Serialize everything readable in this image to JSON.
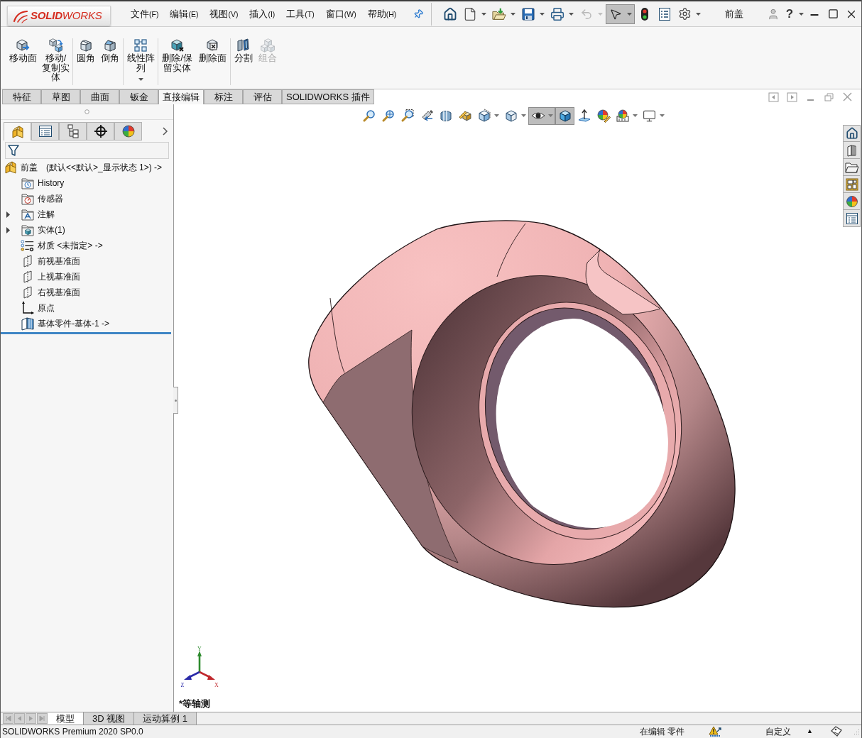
{
  "logo": {
    "text": "**SOLID**WORKS"
  },
  "menu": [
    {
      "label": "文件",
      "key": "(F)"
    },
    {
      "label": "编辑",
      "key": "(E)"
    },
    {
      "label": "视图",
      "key": "(V)"
    },
    {
      "label": "插入",
      "key": "(I)"
    },
    {
      "label": "工具",
      "key": "(T)"
    },
    {
      "label": "窗口",
      "key": "(W)"
    },
    {
      "label": "帮助",
      "key": "(H)"
    }
  ],
  "quick_access": [
    {
      "kind": "home",
      "dropdown": false,
      "disabled": false,
      "selected": false
    },
    {
      "kind": "new",
      "dropdown": true,
      "disabled": false,
      "selected": false
    },
    {
      "kind": "open",
      "dropdown": true,
      "disabled": false,
      "selected": false
    },
    {
      "kind": "save",
      "dropdown": true,
      "disabled": false,
      "selected": false
    },
    {
      "kind": "print",
      "dropdown": true,
      "disabled": false,
      "selected": false
    },
    {
      "kind": "undo",
      "dropdown": true,
      "disabled": true,
      "selected": false
    },
    {
      "kind": "select",
      "dropdown": true,
      "disabled": false,
      "selected": true
    },
    {
      "kind": "rebuild",
      "dropdown": false,
      "disabled": false,
      "selected": false
    },
    {
      "kind": "file-properties",
      "dropdown": false,
      "disabled": false,
      "selected": false
    },
    {
      "kind": "options",
      "dropdown": true,
      "disabled": false,
      "selected": false
    }
  ],
  "window": {
    "title": "前盖",
    "help": "?"
  },
  "ribbon": [
    {
      "commands": [
        {
          "kind": "move-face",
          "label": "移动面",
          "dropdown": false,
          "disabled": false
        },
        {
          "kind": "move-copy-body",
          "label": "移动/复制实体",
          "dropdown": false,
          "disabled": false
        }
      ]
    },
    {
      "commands": [
        {
          "kind": "fillet",
          "label": "圆角",
          "dropdown": false,
          "disabled": false
        },
        {
          "kind": "chamfer",
          "label": "倒角",
          "dropdown": false,
          "disabled": false
        }
      ]
    },
    {
      "commands": [
        {
          "kind": "linear-pattern",
          "label": "线性阵列",
          "dropdown": true,
          "disabled": false
        }
      ]
    },
    {
      "commands": [
        {
          "kind": "delete-keep-body",
          "label": "删除/保留实体",
          "dropdown": false,
          "disabled": false
        },
        {
          "kind": "delete-face",
          "label": "删除面",
          "dropdown": false,
          "disabled": false
        }
      ]
    },
    {
      "commands": [
        {
          "kind": "split",
          "label": "分割",
          "dropdown": false,
          "disabled": false
        },
        {
          "kind": "combine",
          "label": "组合",
          "dropdown": false,
          "disabled": true
        }
      ]
    }
  ],
  "command_tabs": [
    {
      "label": "特征",
      "selected": false
    },
    {
      "label": "草图",
      "selected": false
    },
    {
      "label": "曲面",
      "selected": false
    },
    {
      "label": "钣金",
      "selected": false
    },
    {
      "label": "直接编辑",
      "selected": true
    },
    {
      "label": "标注",
      "selected": false
    },
    {
      "label": "评估",
      "selected": false
    },
    {
      "label": "SOLIDWORKS 插件",
      "selected": false
    }
  ],
  "feature_manager": {
    "tabs": [
      {
        "kind": "feature-tree",
        "selected": true
      },
      {
        "kind": "property-manager",
        "selected": false
      },
      {
        "kind": "configuration-manager",
        "selected": false
      },
      {
        "kind": "dimxpert",
        "selected": false
      },
      {
        "kind": "display-manager",
        "selected": false
      }
    ],
    "tree": {
      "kind": "part",
      "label": "前盖",
      "config": "(默认<<默认>_显示状态 1>) ->",
      "children": [
        {
          "kind": "history",
          "label": "History"
        },
        {
          "kind": "sensors",
          "label": "传感器"
        },
        {
          "kind": "annotations",
          "label": "注解",
          "expanded": false
        },
        {
          "kind": "solid-bodies",
          "label": "实体(1)",
          "expanded": false
        },
        {
          "kind": "material",
          "label": "材质 <未指定> ->"
        },
        {
          "kind": "plane",
          "label": "前视基准面"
        },
        {
          "kind": "plane",
          "label": "上视基准面"
        },
        {
          "kind": "plane",
          "label": "右视基准面"
        },
        {
          "kind": "origin",
          "label": "原点"
        },
        {
          "kind": "base-part",
          "label": "基体零件-基体-1 ->"
        }
      ]
    }
  },
  "view_toolbar": [
    {
      "kind": "zoom-fit",
      "dropdown": false,
      "selected": false
    },
    {
      "kind": "zoom-area",
      "dropdown": false,
      "selected": false
    },
    {
      "kind": "zoom-selection",
      "dropdown": false,
      "selected": false
    },
    {
      "kind": "previous-view",
      "dropdown": false,
      "selected": false
    },
    {
      "kind": "section-view",
      "dropdown": false,
      "selected": false
    },
    {
      "kind": "dynamic-annotation",
      "dropdown": false,
      "selected": false
    },
    {
      "kind": "view-orientation",
      "dropdown": true,
      "selected": false
    },
    {
      "kind": "display-style",
      "dropdown": true,
      "selected": false
    },
    {
      "kind": "hide-show",
      "dropdown": true,
      "selected": true
    },
    {
      "kind": "shaded",
      "dropdown": false,
      "selected": true
    },
    {
      "kind": "normal-axis",
      "dropdown": false,
      "selected": false
    },
    {
      "kind": "edit-appearance",
      "dropdown": false,
      "selected": false
    },
    {
      "kind": "apply-scene",
      "dropdown": true,
      "selected": false
    },
    {
      "kind": "view-settings",
      "dropdown": true,
      "selected": false
    }
  ],
  "graphics": {
    "view_name": "*等轴测",
    "triad": {
      "x": "X",
      "y": "Y",
      "z": "Z"
    }
  },
  "model_tabs": [
    {
      "label": "模型",
      "selected": true
    },
    {
      "label": "3D 视图",
      "selected": false
    },
    {
      "label": "运动算例 1",
      "selected": false
    }
  ],
  "status_bar": {
    "product": "SOLIDWORKS Premium 2020 SP0.0",
    "mode": "在编辑 零件",
    "units": "自定义",
    "units_caret": "▲"
  }
}
